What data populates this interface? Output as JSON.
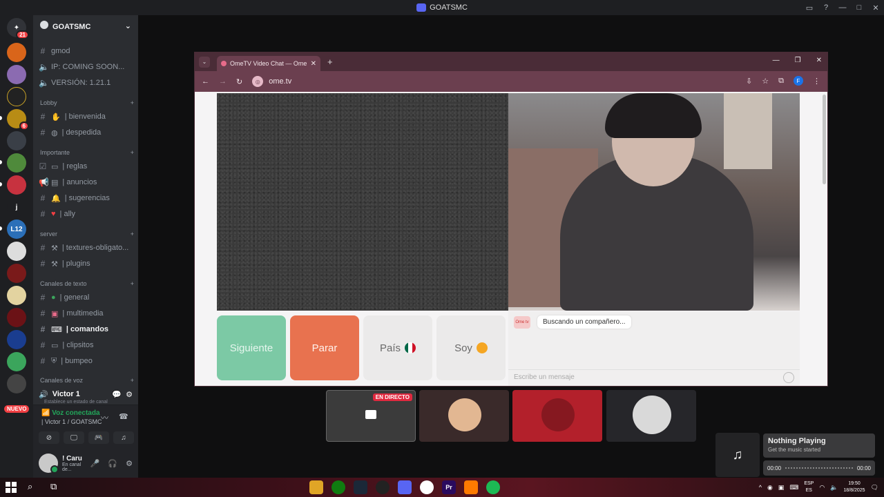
{
  "window": {
    "title": "GOATSMC",
    "controls": [
      "▭",
      "?",
      "—",
      "□",
      "✕"
    ]
  },
  "server_rail": {
    "badges": {
      "home": "21",
      "gold": "6"
    },
    "labels": {
      "j": "j",
      "l12": "L12"
    },
    "nuevo": "NUEVO"
  },
  "guild": {
    "name": "GOATSMC"
  },
  "channels": {
    "gmod": "gmod",
    "ip": "IP: COMING SOON...",
    "version": "VERSIÓN: 1.21.1",
    "cat_lobby": "Lobby",
    "bienvenida": "| bienvenida",
    "despedida": "| despedida",
    "cat_importante": "Importante",
    "reglas": "| reglas",
    "anuncios": "| anuncios",
    "sugerencias": "| sugerencias",
    "ally": "| ally",
    "cat_server": "server",
    "textures": "| textures-obligato...",
    "plugins": "| plugins",
    "cat_texto": "Canales de texto",
    "general": "| general",
    "multimedia": "| multimedia",
    "comandos": "| comandos",
    "clipsitos": "| clipsitos",
    "bumpeo": "| bumpeo",
    "cat_voz": "Canales de voz"
  },
  "voice_channel": {
    "name": "Victor 1",
    "status_hint": "Establece un estado de canal"
  },
  "voice_panel": {
    "status": "Voz conectada",
    "location": "| Victor 1 / GOATSMC"
  },
  "user": {
    "name": "! Caru",
    "status": "En canal de..."
  },
  "browser": {
    "tab_title": "OmeTV Video Chat — Ome",
    "url": "ome.tv",
    "profile_initial": "F"
  },
  "ometv": {
    "next_label": "Siguiente",
    "stop_label": "Parar",
    "country_label": "País",
    "soy_label": "Soy",
    "logo_text": "Ome tv",
    "status_message": "Buscando un compañero...",
    "message_placeholder": "Escribe un mensaje"
  },
  "stream_thumbs": {
    "live_label": "EN DIRECTO"
  },
  "music": {
    "title": "Nothing Playing",
    "subtitle": "Get the music started",
    "time_start": "00:00",
    "time_end": "00:00"
  },
  "taskbar": {
    "lang_top": "ESP",
    "lang_bottom": "ES",
    "time": "19:50",
    "date": "18/8/2025",
    "app_ps": "Pr"
  },
  "colors": {
    "discord_bg": "#2b2d31",
    "ome_next": "#7cc9a5",
    "ome_stop": "#e8724f",
    "voice_green": "#23a55a",
    "live_red": "#e0293f"
  }
}
